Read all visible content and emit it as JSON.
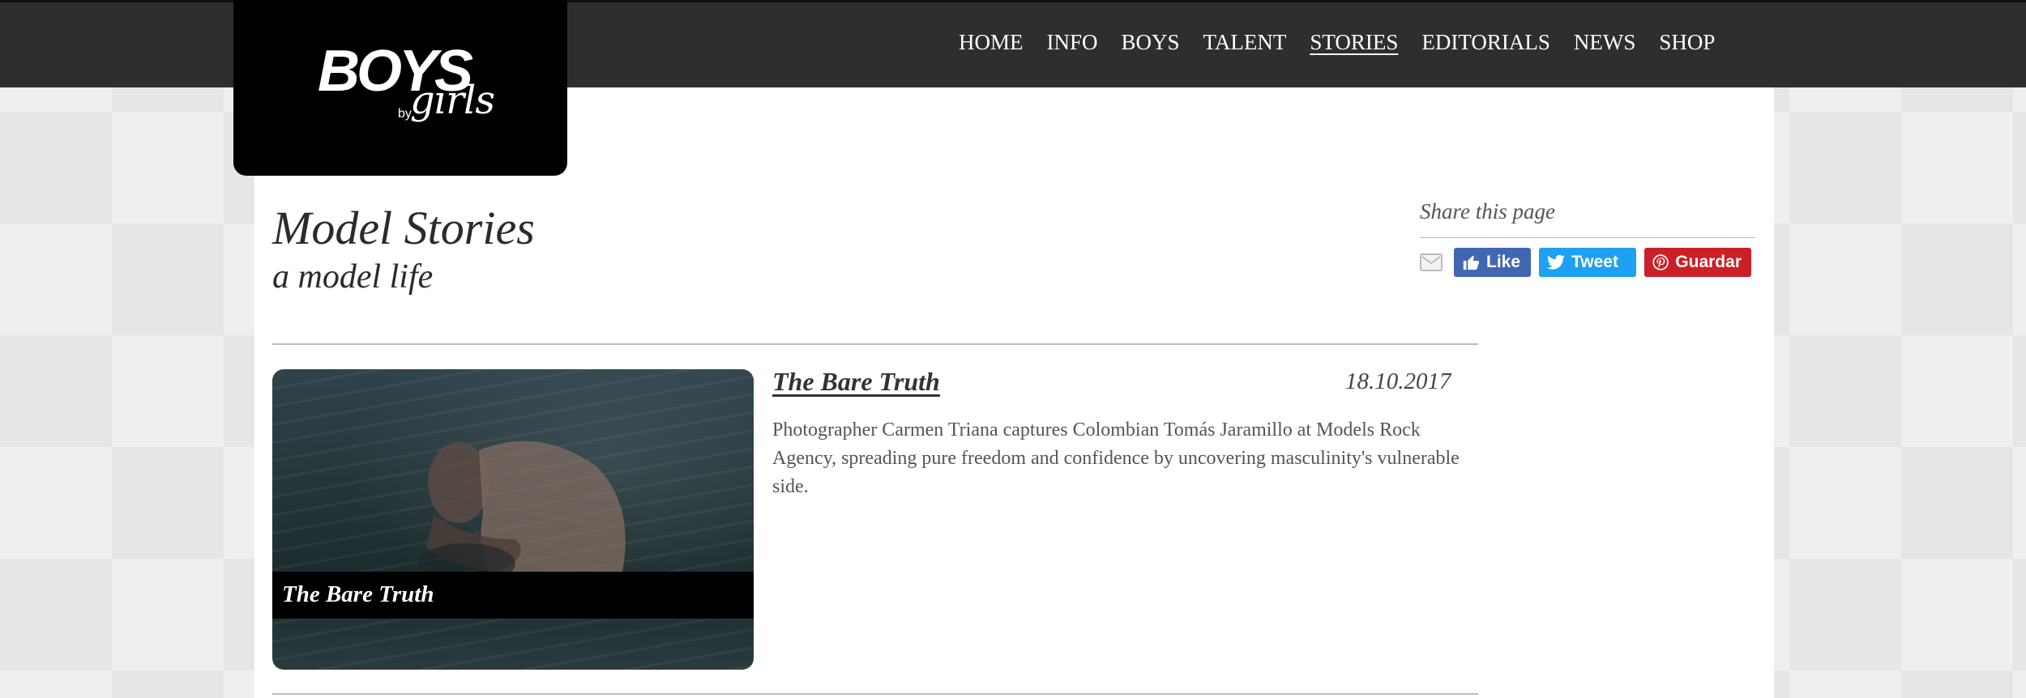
{
  "brand": {
    "logo_main": "BOYS",
    "logo_by": "by",
    "logo_sub": "girls"
  },
  "nav": {
    "items": [
      {
        "label": "HOME"
      },
      {
        "label": "INFO"
      },
      {
        "label": "BOYS"
      },
      {
        "label": "TALENT"
      },
      {
        "label": "STORIES",
        "active": true
      },
      {
        "label": "EDITORIALS"
      },
      {
        "label": "NEWS"
      },
      {
        "label": "SHOP"
      }
    ]
  },
  "page": {
    "title": "Model Stories",
    "subtitle": "a model life"
  },
  "share": {
    "label": "Share this page",
    "email_icon": "email-icon",
    "facebook_label": "Like",
    "twitter_label": "Tweet",
    "pinterest_label": "Guardar"
  },
  "story": {
    "title": "The Bare Truth",
    "date": "18.10.2017",
    "image_caption": "The Bare Truth",
    "description": "Photographer Carmen Triana captures Colombian Tomás Jaramillo at Models Rock Agency, spreading pure freedom and confidence by uncovering masculinity's vulnerable side."
  },
  "colors": {
    "topbar": "#2e2e2e",
    "facebook": "#4267b2",
    "twitter": "#1da1f2",
    "pinterest": "#cb2027"
  }
}
